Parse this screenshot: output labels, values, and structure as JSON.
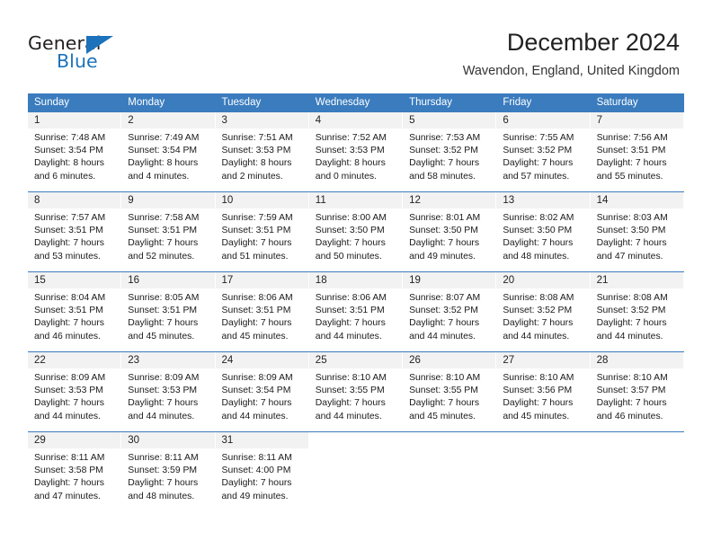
{
  "brand": {
    "name_part1": "General",
    "name_part2": "Blue",
    "triangle_color": "#1c72bb"
  },
  "header": {
    "title": "December 2024",
    "subtitle": "Wavendon, England, United Kingdom"
  },
  "theme": {
    "header_blue": "#3a7cbe",
    "daynum_bg": "#f2f2f2",
    "text": "#1a1a1a"
  },
  "weekdays": [
    "Sunday",
    "Monday",
    "Tuesday",
    "Wednesday",
    "Thursday",
    "Friday",
    "Saturday"
  ],
  "weeks": [
    [
      {
        "day": "1",
        "sunrise": "Sunrise: 7:48 AM",
        "sunset": "Sunset: 3:54 PM",
        "daylight1": "Daylight: 8 hours",
        "daylight2": "and 6 minutes."
      },
      {
        "day": "2",
        "sunrise": "Sunrise: 7:49 AM",
        "sunset": "Sunset: 3:54 PM",
        "daylight1": "Daylight: 8 hours",
        "daylight2": "and 4 minutes."
      },
      {
        "day": "3",
        "sunrise": "Sunrise: 7:51 AM",
        "sunset": "Sunset: 3:53 PM",
        "daylight1": "Daylight: 8 hours",
        "daylight2": "and 2 minutes."
      },
      {
        "day": "4",
        "sunrise": "Sunrise: 7:52 AM",
        "sunset": "Sunset: 3:53 PM",
        "daylight1": "Daylight: 8 hours",
        "daylight2": "and 0 minutes."
      },
      {
        "day": "5",
        "sunrise": "Sunrise: 7:53 AM",
        "sunset": "Sunset: 3:52 PM",
        "daylight1": "Daylight: 7 hours",
        "daylight2": "and 58 minutes."
      },
      {
        "day": "6",
        "sunrise": "Sunrise: 7:55 AM",
        "sunset": "Sunset: 3:52 PM",
        "daylight1": "Daylight: 7 hours",
        "daylight2": "and 57 minutes."
      },
      {
        "day": "7",
        "sunrise": "Sunrise: 7:56 AM",
        "sunset": "Sunset: 3:51 PM",
        "daylight1": "Daylight: 7 hours",
        "daylight2": "and 55 minutes."
      }
    ],
    [
      {
        "day": "8",
        "sunrise": "Sunrise: 7:57 AM",
        "sunset": "Sunset: 3:51 PM",
        "daylight1": "Daylight: 7 hours",
        "daylight2": "and 53 minutes."
      },
      {
        "day": "9",
        "sunrise": "Sunrise: 7:58 AM",
        "sunset": "Sunset: 3:51 PM",
        "daylight1": "Daylight: 7 hours",
        "daylight2": "and 52 minutes."
      },
      {
        "day": "10",
        "sunrise": "Sunrise: 7:59 AM",
        "sunset": "Sunset: 3:51 PM",
        "daylight1": "Daylight: 7 hours",
        "daylight2": "and 51 minutes."
      },
      {
        "day": "11",
        "sunrise": "Sunrise: 8:00 AM",
        "sunset": "Sunset: 3:50 PM",
        "daylight1": "Daylight: 7 hours",
        "daylight2": "and 50 minutes."
      },
      {
        "day": "12",
        "sunrise": "Sunrise: 8:01 AM",
        "sunset": "Sunset: 3:50 PM",
        "daylight1": "Daylight: 7 hours",
        "daylight2": "and 49 minutes."
      },
      {
        "day": "13",
        "sunrise": "Sunrise: 8:02 AM",
        "sunset": "Sunset: 3:50 PM",
        "daylight1": "Daylight: 7 hours",
        "daylight2": "and 48 minutes."
      },
      {
        "day": "14",
        "sunrise": "Sunrise: 8:03 AM",
        "sunset": "Sunset: 3:50 PM",
        "daylight1": "Daylight: 7 hours",
        "daylight2": "and 47 minutes."
      }
    ],
    [
      {
        "day": "15",
        "sunrise": "Sunrise: 8:04 AM",
        "sunset": "Sunset: 3:51 PM",
        "daylight1": "Daylight: 7 hours",
        "daylight2": "and 46 minutes."
      },
      {
        "day": "16",
        "sunrise": "Sunrise: 8:05 AM",
        "sunset": "Sunset: 3:51 PM",
        "daylight1": "Daylight: 7 hours",
        "daylight2": "and 45 minutes."
      },
      {
        "day": "17",
        "sunrise": "Sunrise: 8:06 AM",
        "sunset": "Sunset: 3:51 PM",
        "daylight1": "Daylight: 7 hours",
        "daylight2": "and 45 minutes."
      },
      {
        "day": "18",
        "sunrise": "Sunrise: 8:06 AM",
        "sunset": "Sunset: 3:51 PM",
        "daylight1": "Daylight: 7 hours",
        "daylight2": "and 44 minutes."
      },
      {
        "day": "19",
        "sunrise": "Sunrise: 8:07 AM",
        "sunset": "Sunset: 3:52 PM",
        "daylight1": "Daylight: 7 hours",
        "daylight2": "and 44 minutes."
      },
      {
        "day": "20",
        "sunrise": "Sunrise: 8:08 AM",
        "sunset": "Sunset: 3:52 PM",
        "daylight1": "Daylight: 7 hours",
        "daylight2": "and 44 minutes."
      },
      {
        "day": "21",
        "sunrise": "Sunrise: 8:08 AM",
        "sunset": "Sunset: 3:52 PM",
        "daylight1": "Daylight: 7 hours",
        "daylight2": "and 44 minutes."
      }
    ],
    [
      {
        "day": "22",
        "sunrise": "Sunrise: 8:09 AM",
        "sunset": "Sunset: 3:53 PM",
        "daylight1": "Daylight: 7 hours",
        "daylight2": "and 44 minutes."
      },
      {
        "day": "23",
        "sunrise": "Sunrise: 8:09 AM",
        "sunset": "Sunset: 3:53 PM",
        "daylight1": "Daylight: 7 hours",
        "daylight2": "and 44 minutes."
      },
      {
        "day": "24",
        "sunrise": "Sunrise: 8:09 AM",
        "sunset": "Sunset: 3:54 PM",
        "daylight1": "Daylight: 7 hours",
        "daylight2": "and 44 minutes."
      },
      {
        "day": "25",
        "sunrise": "Sunrise: 8:10 AM",
        "sunset": "Sunset: 3:55 PM",
        "daylight1": "Daylight: 7 hours",
        "daylight2": "and 44 minutes."
      },
      {
        "day": "26",
        "sunrise": "Sunrise: 8:10 AM",
        "sunset": "Sunset: 3:55 PM",
        "daylight1": "Daylight: 7 hours",
        "daylight2": "and 45 minutes."
      },
      {
        "day": "27",
        "sunrise": "Sunrise: 8:10 AM",
        "sunset": "Sunset: 3:56 PM",
        "daylight1": "Daylight: 7 hours",
        "daylight2": "and 45 minutes."
      },
      {
        "day": "28",
        "sunrise": "Sunrise: 8:10 AM",
        "sunset": "Sunset: 3:57 PM",
        "daylight1": "Daylight: 7 hours",
        "daylight2": "and 46 minutes."
      }
    ],
    [
      {
        "day": "29",
        "sunrise": "Sunrise: 8:11 AM",
        "sunset": "Sunset: 3:58 PM",
        "daylight1": "Daylight: 7 hours",
        "daylight2": "and 47 minutes."
      },
      {
        "day": "30",
        "sunrise": "Sunrise: 8:11 AM",
        "sunset": "Sunset: 3:59 PM",
        "daylight1": "Daylight: 7 hours",
        "daylight2": "and 48 minutes."
      },
      {
        "day": "31",
        "sunrise": "Sunrise: 8:11 AM",
        "sunset": "Sunset: 4:00 PM",
        "daylight1": "Daylight: 7 hours",
        "daylight2": "and 49 minutes."
      },
      {
        "day": "",
        "sunrise": "",
        "sunset": "",
        "daylight1": "",
        "daylight2": ""
      },
      {
        "day": "",
        "sunrise": "",
        "sunset": "",
        "daylight1": "",
        "daylight2": ""
      },
      {
        "day": "",
        "sunrise": "",
        "sunset": "",
        "daylight1": "",
        "daylight2": ""
      },
      {
        "day": "",
        "sunrise": "",
        "sunset": "",
        "daylight1": "",
        "daylight2": ""
      }
    ]
  ]
}
